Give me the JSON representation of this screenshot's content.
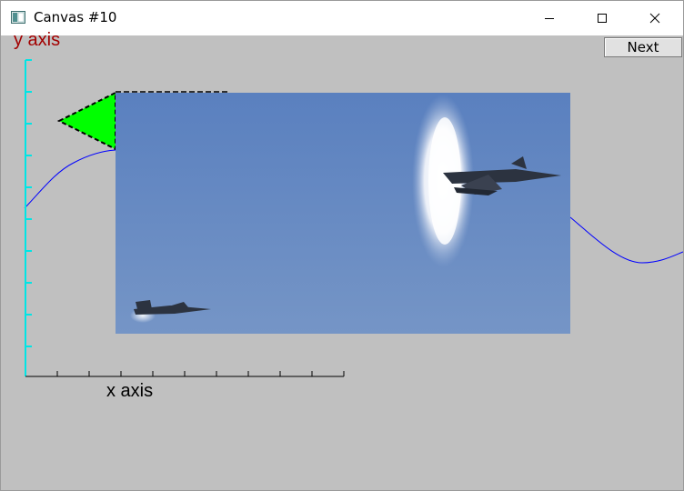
{
  "window": {
    "title": "Canvas #10",
    "icon": "app-window-icon",
    "controls": [
      "minimize-icon",
      "maximize-icon",
      "close-icon"
    ]
  },
  "toolbar": {
    "next_label": "Next"
  },
  "plot": {
    "y_axis_label": "y axis",
    "x_axis_label": "x axis",
    "curve_color": "#0000ff",
    "y_axis_label_color": "#a30000",
    "y_axis_color": "#00e5e5",
    "x_axis_color": "#000000",
    "triangle_color": "#00ff00"
  },
  "image": {
    "subject": "jet-aircraft-sonic-boom-photo",
    "sky_color": "#6a8fc4"
  }
}
